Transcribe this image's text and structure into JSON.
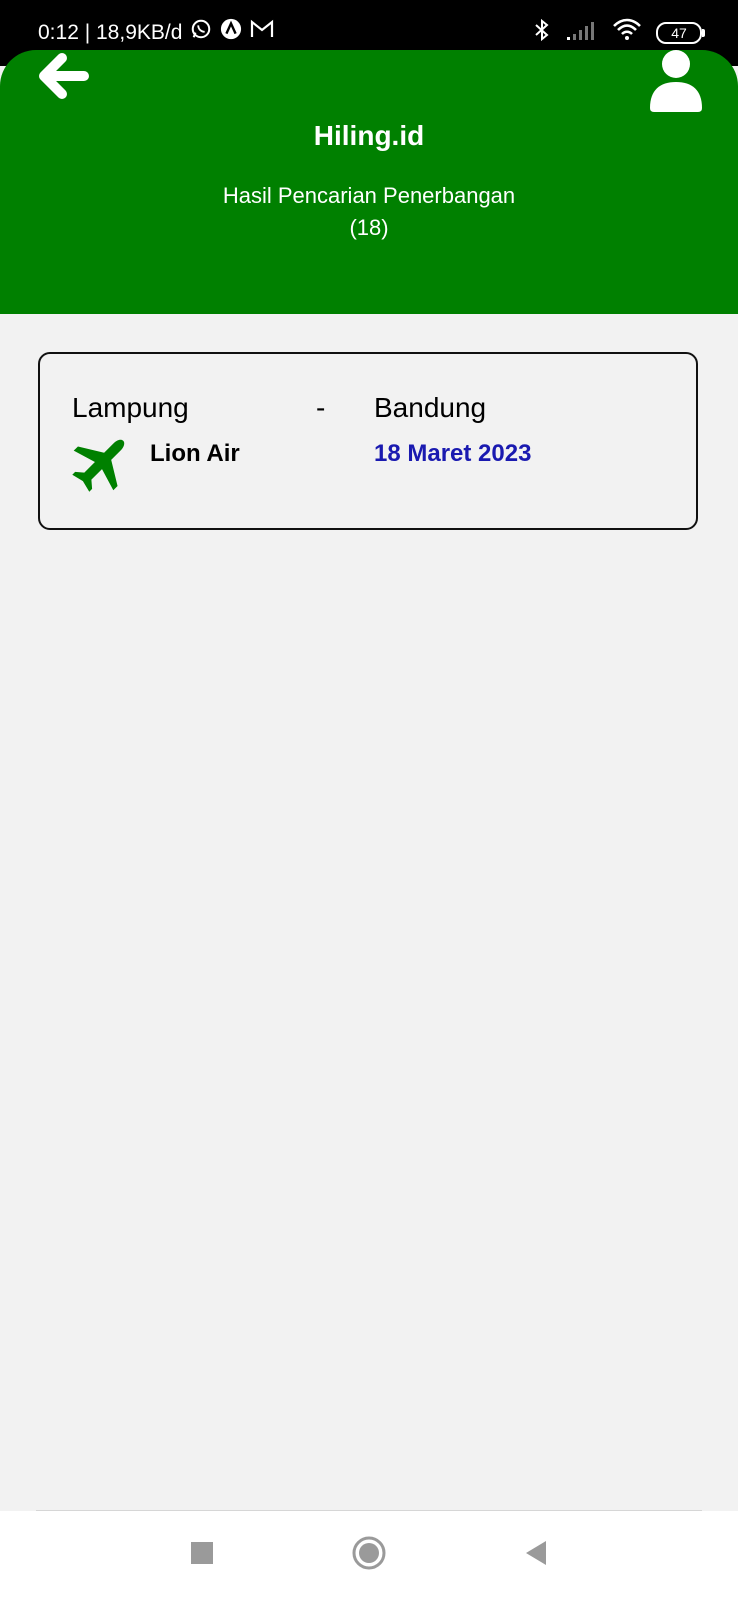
{
  "status_bar": {
    "time_speed": "0:12 | 18,9KB/d",
    "battery": "47"
  },
  "header": {
    "title": "Hiling.id",
    "subtitle_line1": "Hasil Pencarian Penerbangan",
    "subtitle_line2": "(18)"
  },
  "flight": {
    "origin": "Lampung",
    "separator": "-",
    "destination": "Bandung",
    "airline": "Lion Air",
    "date": "18 Maret 2023"
  },
  "colors": {
    "header_green": "#008000",
    "plane_green": "#008000",
    "date_blue": "#1a1ab0",
    "background": "#f2f2f2"
  },
  "icons": {
    "back": "arrow-left-icon",
    "profile": "user-icon",
    "plane": "airplane-icon"
  }
}
